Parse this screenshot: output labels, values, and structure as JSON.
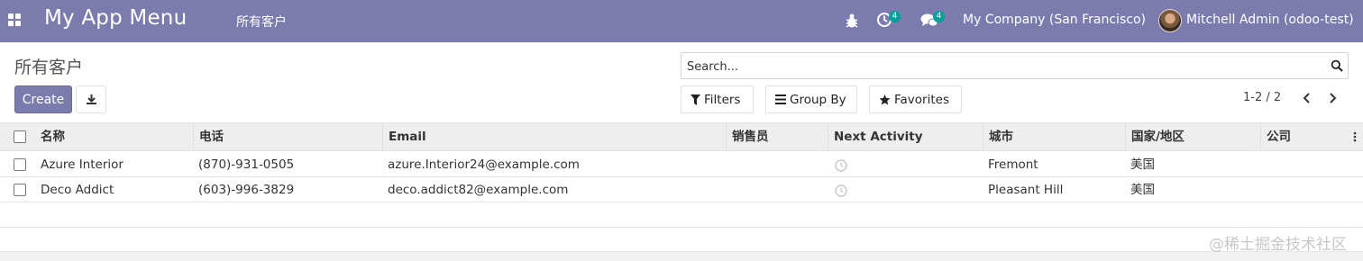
{
  "navbar": {
    "apps_icon": "grid-icon",
    "brand": "My App Menu",
    "menu_section": "所有客户",
    "debug_icon": "bug-icon",
    "activity_icon": "clock-icon",
    "activity_count": "4",
    "messages_icon": "chat-icon",
    "messages_count": "4",
    "company": "My Company (San Francisco)",
    "user_name": "Mitchell Admin (odoo-test)",
    "brand_color": "#7c7bad",
    "badge_color": "#00a09d"
  },
  "control_panel": {
    "title": "所有客户",
    "create_label": "Create",
    "download_icon": "download-icon",
    "search_placeholder": "Search...",
    "filters_label": "Filters",
    "groupby_label": "Group By",
    "favorites_label": "Favorites",
    "pager": "1-2 / 2"
  },
  "table": {
    "columns": [
      "名称",
      "电话",
      "Email",
      "销售员",
      "Next Activity",
      "城市",
      "国家/地区",
      "公司"
    ],
    "rows": [
      {
        "name": "Azure Interior",
        "phone": "(870)-931-0505",
        "email": "azure.Interior24@example.com",
        "salesperson": "",
        "city": "Fremont",
        "country": "美国",
        "company": ""
      },
      {
        "name": "Deco Addict",
        "phone": "(603)-996-3829",
        "email": "deco.addict82@example.com",
        "salesperson": "",
        "city": "Pleasant Hill",
        "country": "美国",
        "company": ""
      }
    ]
  },
  "watermark": "@稀土掘金技术社区"
}
